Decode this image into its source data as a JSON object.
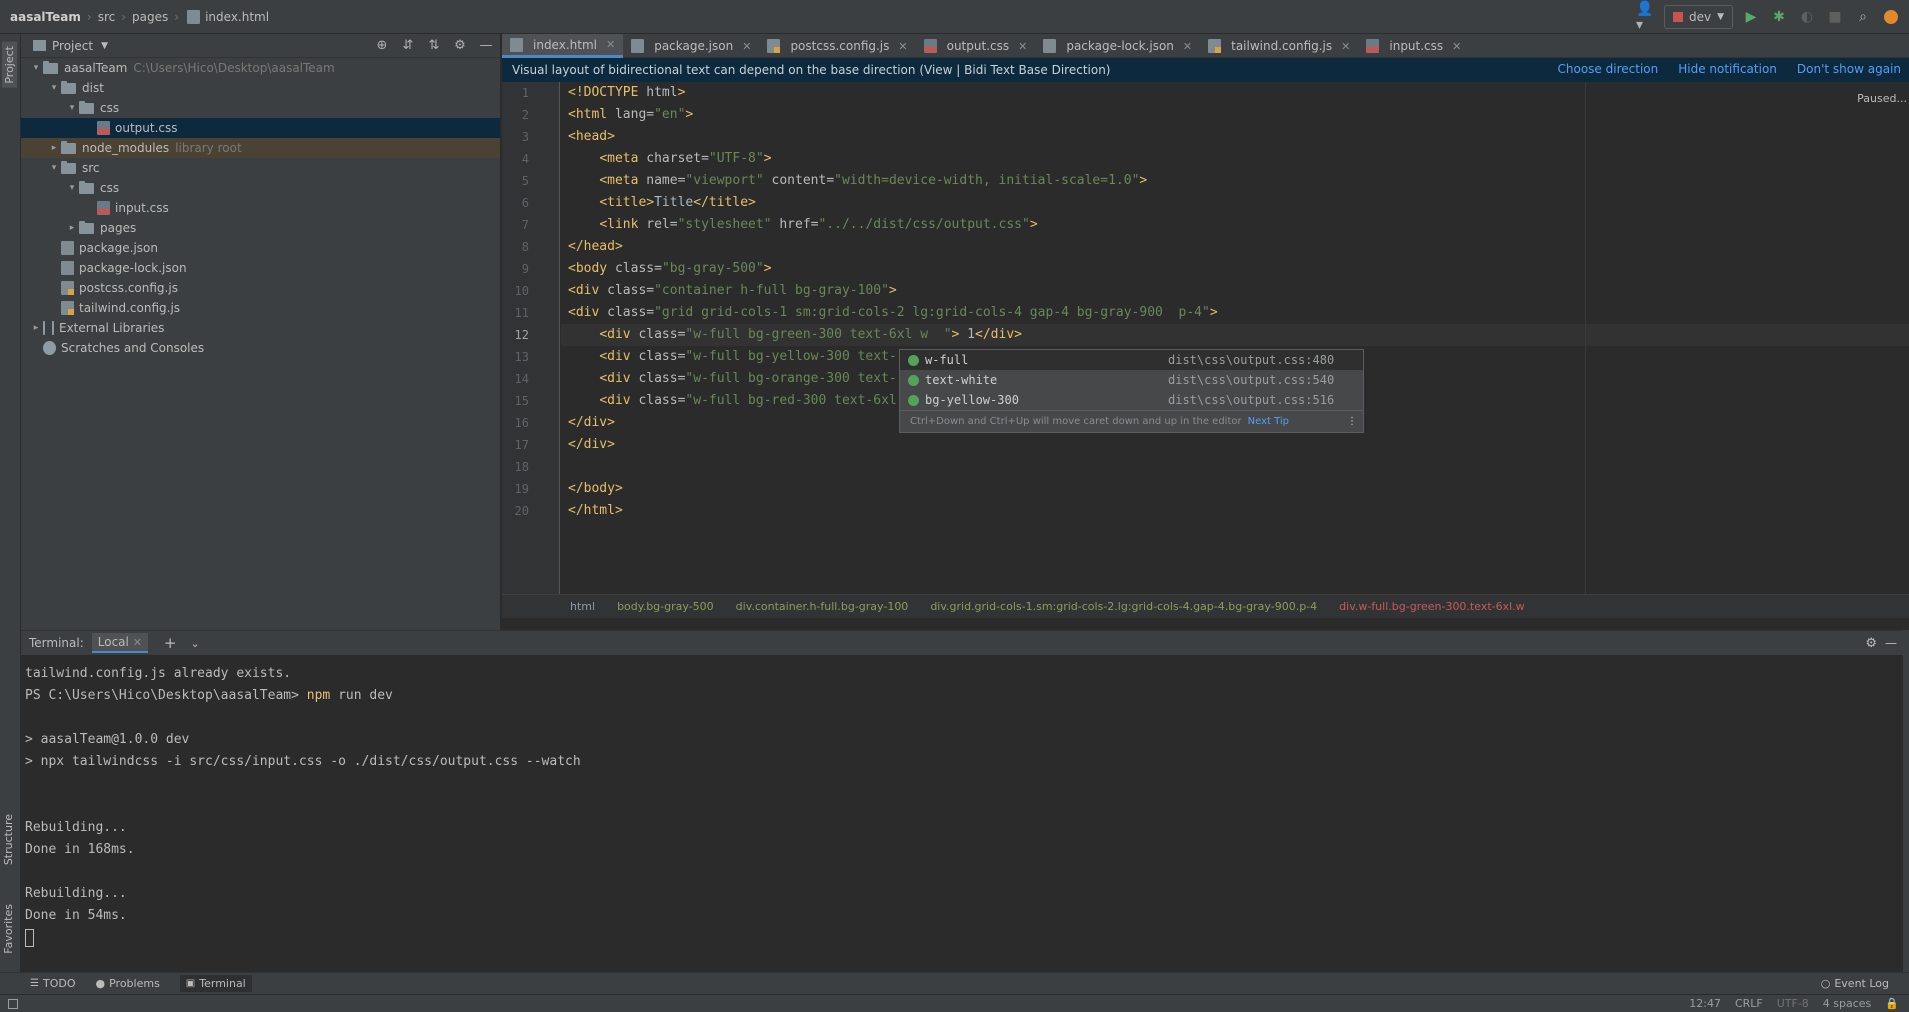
{
  "navbar": {
    "crumbs": [
      "aasalTeam",
      "src",
      "pages",
      "index.html"
    ],
    "run_config": "dev"
  },
  "left_stripe": {
    "project": "Project",
    "structure": "Structure",
    "favorites": "Favorites"
  },
  "project": {
    "title": "Project",
    "tree": [
      {
        "label": "aasalTeam",
        "hint": "C:\\Users\\Hico\\Desktop\\aasalTeam",
        "indent": 0,
        "icon": "folder-icon",
        "arrow": "▾"
      },
      {
        "label": "dist",
        "indent": 1,
        "icon": "folder-icon",
        "arrow": "▾"
      },
      {
        "label": "css",
        "indent": 2,
        "icon": "folder-icon",
        "arrow": "▾"
      },
      {
        "label": "output.css",
        "indent": 3,
        "icon": "css-file-icon",
        "arrow": ""
      },
      {
        "label": "node_modules",
        "hint": "library root",
        "indent": 1,
        "icon": "folder-icon",
        "arrow": "▸"
      },
      {
        "label": "src",
        "indent": 1,
        "icon": "folder-icon",
        "arrow": "▾"
      },
      {
        "label": "css",
        "indent": 2,
        "icon": "folder-icon",
        "arrow": "▾"
      },
      {
        "label": "input.css",
        "indent": 3,
        "icon": "css-file-icon",
        "arrow": ""
      },
      {
        "label": "pages",
        "indent": 2,
        "icon": "folder-icon",
        "arrow": "▸"
      },
      {
        "label": "package.json",
        "indent": 1,
        "icon": "json-file-icon",
        "arrow": ""
      },
      {
        "label": "package-lock.json",
        "indent": 1,
        "icon": "json-file-icon",
        "arrow": ""
      },
      {
        "label": "postcss.config.js",
        "indent": 1,
        "icon": "js-file-icon",
        "arrow": ""
      },
      {
        "label": "tailwind.config.js",
        "indent": 1,
        "icon": "js-file-icon",
        "arrow": ""
      },
      {
        "label": "External Libraries",
        "indent": 0,
        "icon": "library-icon",
        "arrow": "▸"
      },
      {
        "label": "Scratches and Consoles",
        "indent": 0,
        "icon": "scratch-icon",
        "arrow": ""
      }
    ]
  },
  "editor": {
    "tabs": [
      "index.html",
      "package.json",
      "postcss.config.js",
      "output.css",
      "package-lock.json",
      "tailwind.config.js",
      "input.css"
    ],
    "notification": "Visual layout of bidirectional text can depend on the base direction (View | Bidi Text Base Direction)",
    "notification_links": [
      "Choose direction",
      "Hide notification",
      "Don't show again"
    ],
    "paused": "Paused...",
    "line_numbers": [
      "1",
      "2",
      "3",
      "4",
      "5",
      "6",
      "7",
      "8",
      "9",
      "10",
      "11",
      "12",
      "13",
      "14",
      "15",
      "16",
      "17",
      "18",
      "19",
      "20"
    ],
    "breadcrumbs": [
      "html",
      "body.bg-gray-500",
      "div.container.h-full.bg-gray-100",
      "div.grid.grid-cols-1.sm:grid-cols-2.lg:grid-cols-4.gap-4.bg-gray-900.p-4",
      "div.w-full.bg-green-300.text-6xl.w"
    ]
  },
  "completion": {
    "items": [
      {
        "name": "w-full",
        "location": "dist\\css\\output.css:480"
      },
      {
        "name": "text-white",
        "location": "dist\\css\\output.css:540"
      },
      {
        "name": "bg-yellow-300",
        "location": "dist\\css\\output.css:516"
      }
    ],
    "footer": "Ctrl+Down and Ctrl+Up will move caret down and up in the editor",
    "tip": "Next Tip"
  },
  "terminal": {
    "title": "Terminal:",
    "tab": "Local",
    "lines": [
      "tailwind.config.js already exists.",
      "PS C:\\Users\\Hico\\Desktop\\aasalTeam> npm run dev",
      "",
      "> aasalTeam@1.0.0 dev",
      "> npx tailwindcss -i src/css/input.css -o ./dist/css/output.css --watch",
      "",
      "",
      "Rebuilding...",
      "Done in 168ms.",
      "",
      "Rebuilding...",
      "Done in 54ms."
    ]
  },
  "bottom_tools": [
    "TODO",
    "Problems",
    "Terminal",
    "Event Log"
  ],
  "status": {
    "time": "12:47",
    "line_sep": "CRLF",
    "encoding": "UTF-8",
    "indent": "4 spaces"
  }
}
